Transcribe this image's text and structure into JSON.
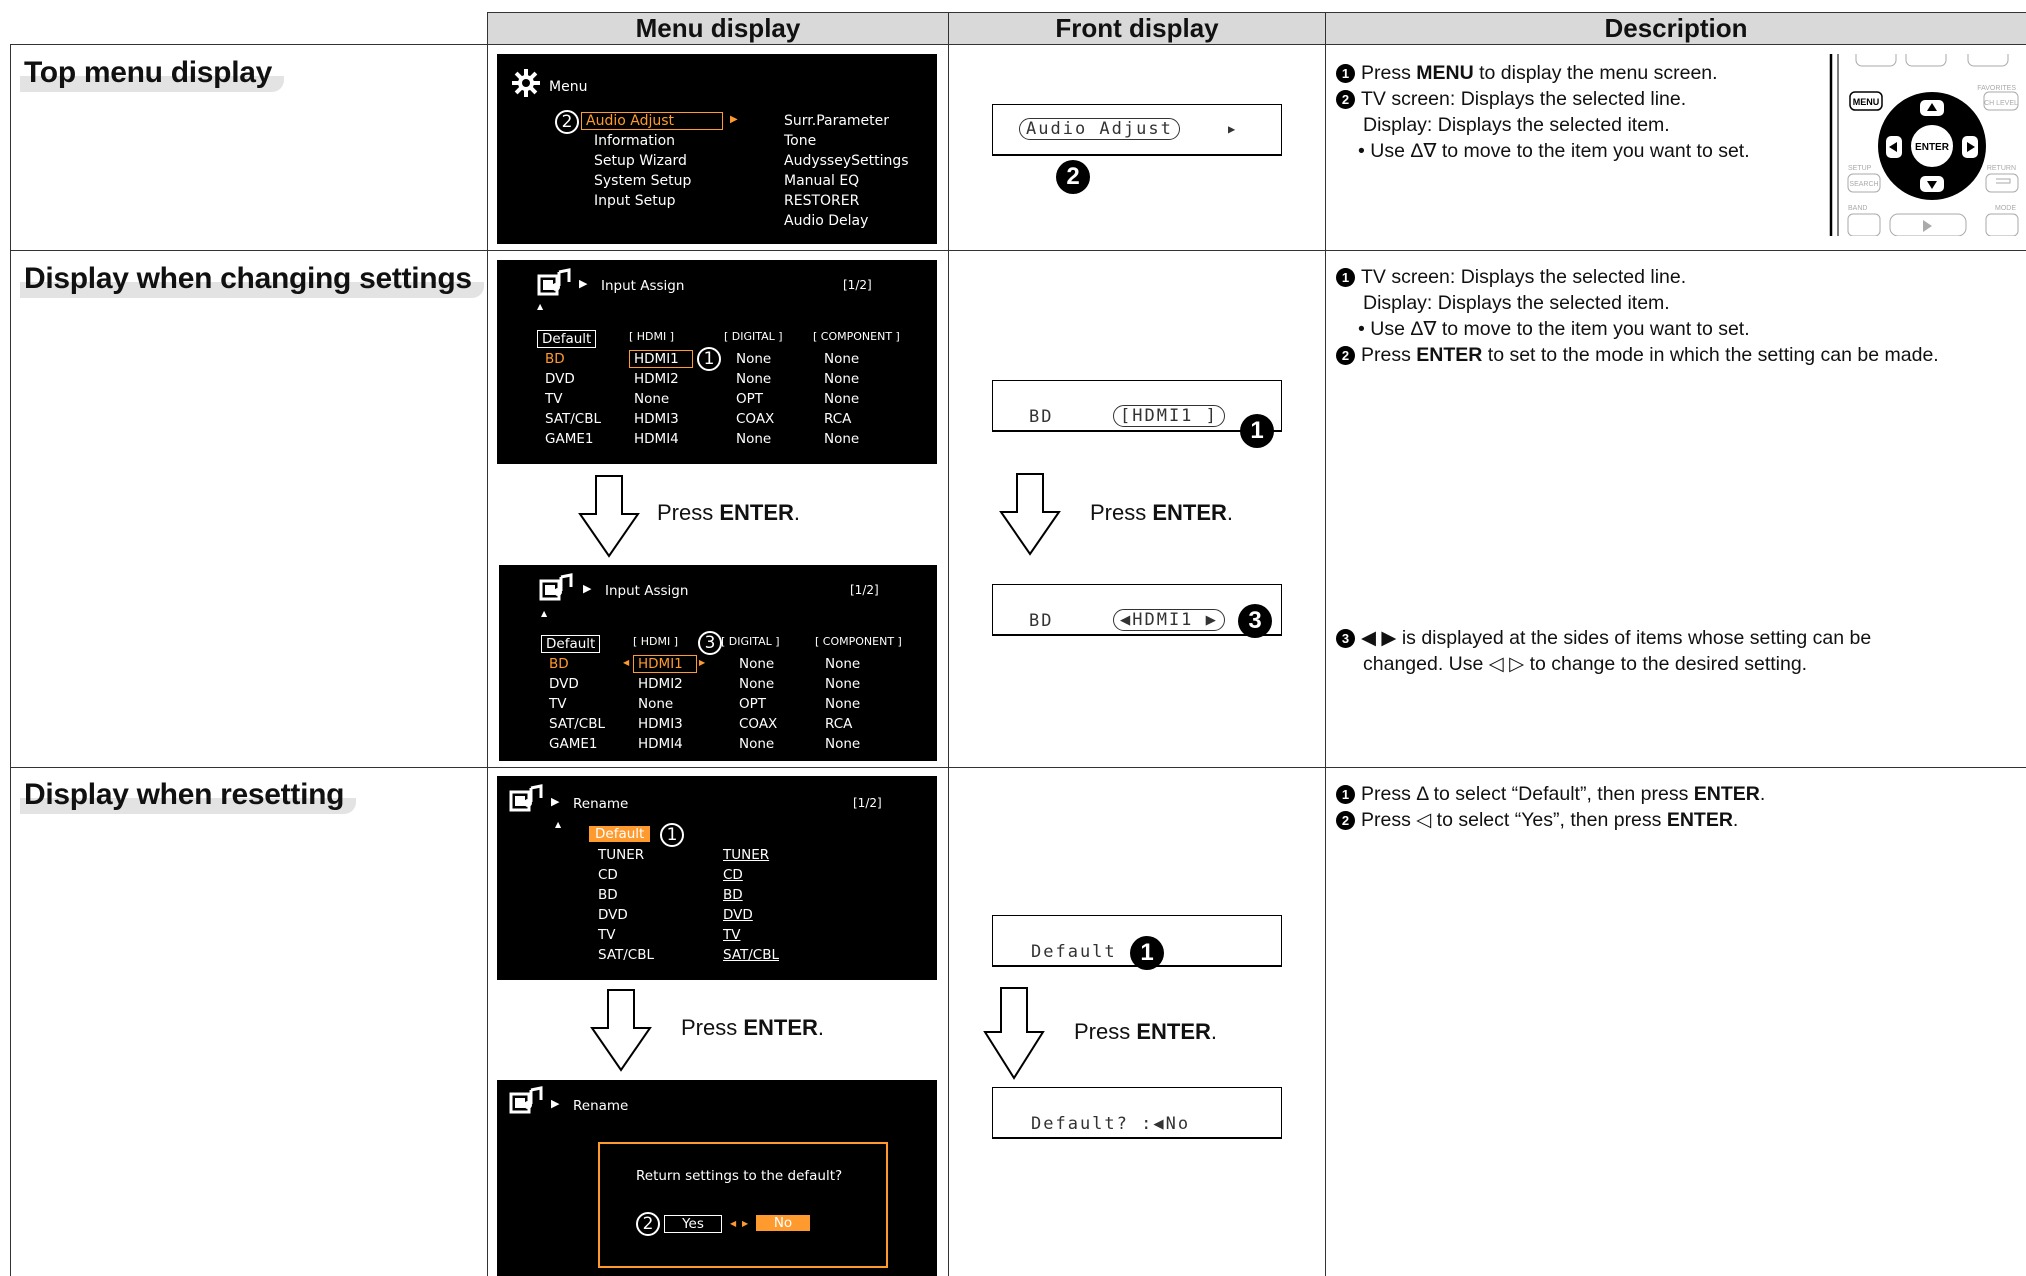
{
  "headers": {
    "menu": "Menu display",
    "front": "Front display",
    "description": "Description"
  },
  "sections": {
    "top": "Top menu display",
    "changing": "Display when changing settings",
    "resetting": "Display when resetting"
  },
  "top_menu": {
    "title": "Menu",
    "marker": "2",
    "left_items": [
      "Audio Adjust",
      "Information",
      "Setup Wizard",
      "System Setup",
      "Input Setup"
    ],
    "right_items": [
      "Surr.Parameter",
      "Tone",
      "AudysseySettings",
      "Manual EQ",
      "RESTORER",
      "Audio Delay"
    ],
    "lcd_text": "Audio Adjust",
    "lcd_marker": "2"
  },
  "input_assign": {
    "title": "Input Assign",
    "page": "[1/2]",
    "columns": [
      "Default",
      "[ HDMI ]",
      "[ DIGITAL ]",
      "[ COMPONENT ]"
    ],
    "rows": [
      [
        "BD",
        "HDMI1",
        "None",
        "None"
      ],
      [
        "DVD",
        "HDMI2",
        "None",
        "None"
      ],
      [
        "TV",
        "None",
        "OPT",
        "None"
      ],
      [
        "SAT/CBL",
        "HDMI3",
        "COAX",
        "RCA"
      ],
      [
        "GAME1",
        "HDMI4",
        "None",
        "None"
      ]
    ],
    "marker1": "1",
    "marker3": "3",
    "lcd1_left": "BD",
    "lcd1_right": "[HDMI1 ]",
    "lcd1_marker": "1",
    "lcd2_left": "BD",
    "lcd2_right": "◀HDMI1 ▶",
    "lcd2_marker": "3"
  },
  "press": {
    "prefix": "Press ",
    "key": "ENTER",
    "suffix": "."
  },
  "rename": {
    "title": "Rename",
    "page": "[1/2]",
    "default_label": "Default",
    "marker1": "1",
    "left_items": [
      "TUNER",
      "CD",
      "BD",
      "DVD",
      "TV",
      "SAT/CBL"
    ],
    "right_items": [
      "TUNER",
      "CD",
      "BD",
      "DVD",
      "TV",
      "SAT/CBL"
    ],
    "dialog_text": "Return settings to the default?",
    "yes": "Yes",
    "no": "No",
    "marker2": "2",
    "lcd1_text": "Default",
    "lcd1_marker": "1",
    "lcd2_text": "Default? :◀No"
  },
  "descriptions": {
    "top": {
      "l1_a": "Press ",
      "l1_b": "MENU",
      "l1_c": " to display the menu screen.",
      "l2": "TV screen: Displays the selected line.",
      "l3": "Display: Displays the selected item.",
      "l4": "• Use Δ∇ to move to the item you want to set."
    },
    "changing": {
      "l1": "TV screen: Displays the selected line.",
      "l2": "Display: Displays the selected item.",
      "l3": "• Use Δ∇ to move to the item you want to set.",
      "l4_a": "Press ",
      "l4_b": "ENTER",
      "l4_c": " to set to the mode in which the setting can be made.",
      "l5": "◀ ▶ is displayed at the sides of items whose setting can be",
      "l6": "changed. Use ◁ ▷ to change to the desired setting."
    },
    "resetting": {
      "l1_a": "Press Δ to select “Default”, then press ",
      "l1_b": "ENTER",
      "l1_c": ".",
      "l2_a": "Press ◁ to select “Yes”, then press ",
      "l2_b": "ENTER",
      "l2_c": "."
    }
  },
  "remote": {
    "menu": "MENU",
    "enter": "ENTER",
    "search": "SEARCH",
    "setup": "SETUP",
    "return": "RETURN",
    "band": "BAND",
    "mode": "MODE",
    "ch_level": "CH LEVEL"
  }
}
